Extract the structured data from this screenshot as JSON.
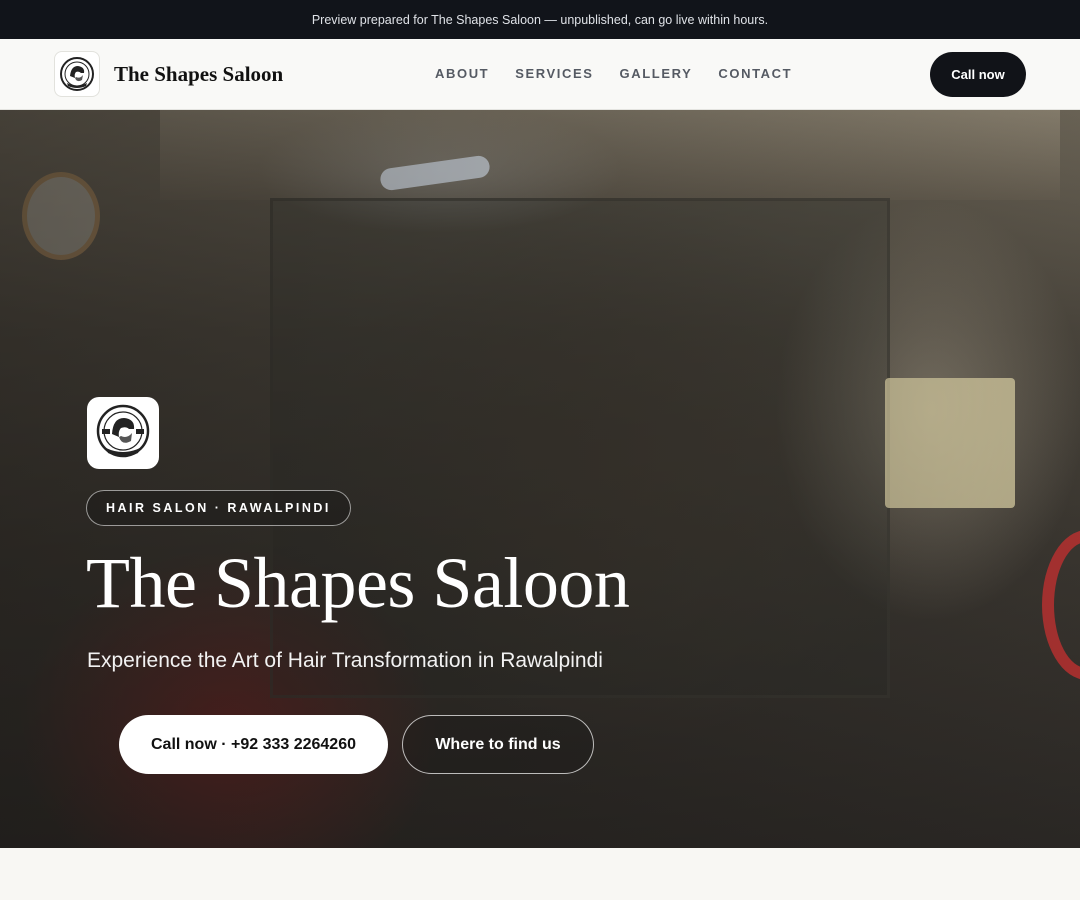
{
  "preview_banner": "Preview prepared for The Shapes Saloon — unpublished, can go live within hours.",
  "header": {
    "logo_icon": "barber-logo-icon",
    "brand_name": "The Shapes Saloon",
    "nav": [
      {
        "label": "ABOUT"
      },
      {
        "label": "SERVICES"
      },
      {
        "label": "GALLERY"
      },
      {
        "label": "CONTACT"
      }
    ],
    "call_label": "Call now"
  },
  "hero": {
    "logo_icon": "barber-logo-icon",
    "badge": "HAIR SALON · RAWALPINDI",
    "title": "The Shapes Saloon",
    "subtitle": "Experience the Art of Hair Transformation in Rawalpindi",
    "primary_button": "Call now · +92 333 2264260",
    "secondary_button": "Where to find us"
  },
  "colors": {
    "dark": "#11141a",
    "header_bg": "#f9f9f7",
    "page_bg": "#f8f7f3",
    "accent": "#111318"
  }
}
